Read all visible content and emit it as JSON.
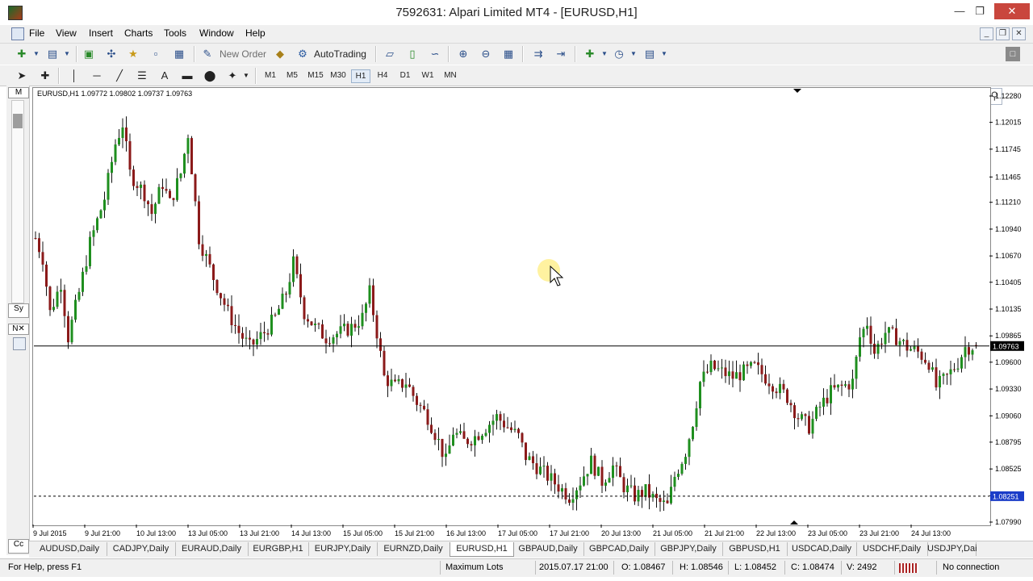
{
  "window": {
    "title": "7592631: Alpari Limited MT4 - [EURUSD,H1]"
  },
  "menu": [
    "File",
    "View",
    "Insert",
    "Charts",
    "Tools",
    "Window",
    "Help"
  ],
  "toolbar": {
    "new_order": "New Order",
    "autotrading": "AutoTrading"
  },
  "timeframes": [
    "M1",
    "M5",
    "M15",
    "M30",
    "H1",
    "H4",
    "D1",
    "W1",
    "MN"
  ],
  "active_timeframe": "H1",
  "chart": {
    "header": "EURUSD,H1  1.09772 1.09802 1.09737 1.09763",
    "price_labels": [
      "1.12280",
      "1.12015",
      "1.11745",
      "1.11465",
      "1.11210",
      "1.10940",
      "1.10670",
      "1.10405",
      "1.10135",
      "1.09865",
      "1.09600",
      "1.09330",
      "1.09060",
      "1.08795",
      "1.08525",
      "1.08255",
      "1.07990"
    ],
    "current_price": "1.09763",
    "line_price": "1.08251",
    "time_labels": [
      "9 Jul 2015",
      "9 Jul 21:00",
      "10 Jul 13:00",
      "13 Jul 05:00",
      "13 Jul 21:00",
      "14 Jul 13:00",
      "15 Jul 05:00",
      "15 Jul 21:00",
      "16 Jul 13:00",
      "17 Jul 05:00",
      "17 Jul 21:00",
      "20 Jul 13:00",
      "21 Jul 05:00",
      "21 Jul 21:00",
      "22 Jul 13:00",
      "23 Jul 05:00",
      "23 Jul 21:00",
      "24 Jul 13:00"
    ],
    "colors": {
      "bull": "#1f8f1f",
      "bear": "#8b1a1a",
      "neutral": "#000000",
      "highlight_cursor": "#fff2a0"
    }
  },
  "chart_data": {
    "type": "candlestick",
    "title": "EURUSD,H1",
    "ylim": [
      1.0799,
      1.1228
    ],
    "close_path": [
      [
        0,
        1.1085
      ],
      [
        2,
        1.1065
      ],
      [
        4,
        1.101
      ],
      [
        7,
        1.104
      ],
      [
        9,
        1.0985
      ],
      [
        12,
        1.103
      ],
      [
        15,
        1.108
      ],
      [
        19,
        1.1125
      ],
      [
        22,
        1.118
      ],
      [
        24,
        1.12
      ],
      [
        26,
        1.115
      ],
      [
        30,
        1.113
      ],
      [
        32,
        1.111
      ],
      [
        35,
        1.114
      ],
      [
        37,
        1.112
      ],
      [
        40,
        1.115
      ],
      [
        42,
        1.119
      ],
      [
        45,
        1.1085
      ],
      [
        49,
        1.1045
      ],
      [
        53,
        1.101
      ],
      [
        56,
        1.099
      ],
      [
        59,
        1.0975
      ],
      [
        63,
        1.099
      ],
      [
        66,
        1.1005
      ],
      [
        69,
        1.103
      ],
      [
        71,
        1.106
      ],
      [
        74,
        1.101
      ],
      [
        77,
        1.0995
      ],
      [
        80,
        1.0985
      ],
      [
        84,
        1.099
      ],
      [
        87,
        1.0995
      ],
      [
        90,
        1.1005
      ],
      [
        92,
        1.103
      ],
      [
        94,
        1.099
      ],
      [
        96,
        1.0945
      ],
      [
        99,
        1.0935
      ],
      [
        102,
        1.094
      ],
      [
        105,
        1.092
      ],
      [
        108,
        1.0905
      ],
      [
        111,
        1.088
      ],
      [
        113,
        1.086
      ],
      [
        115,
        1.089
      ],
      [
        118,
        1.088
      ],
      [
        121,
        1.0885
      ],
      [
        124,
        1.0895
      ],
      [
        127,
        1.0905
      ],
      [
        130,
        1.0895
      ],
      [
        133,
        1.0885
      ],
      [
        135,
        1.0865
      ],
      [
        138,
        1.0855
      ],
      [
        141,
        1.0845
      ],
      [
        144,
        1.0835
      ],
      [
        147,
        1.0825
      ],
      [
        150,
        1.084
      ],
      [
        153,
        1.086
      ],
      [
        156,
        1.084
      ],
      [
        159,
        1.0855
      ],
      [
        162,
        1.0835
      ],
      [
        165,
        1.0825
      ],
      [
        168,
        1.083
      ],
      [
        171,
        1.082
      ],
      [
        174,
        1.0815
      ],
      [
        176,
        1.0845
      ],
      [
        179,
        1.087
      ],
      [
        181,
        1.09
      ],
      [
        183,
        1.094
      ],
      [
        186,
        1.0955
      ],
      [
        189,
        1.095
      ],
      [
        192,
        1.0945
      ],
      [
        195,
        1.095
      ],
      [
        198,
        1.0955
      ],
      [
        201,
        1.0945
      ],
      [
        204,
        1.0935
      ],
      [
        207,
        1.0925
      ],
      [
        210,
        1.0905
      ],
      [
        213,
        1.0895
      ],
      [
        216,
        1.0915
      ],
      [
        219,
        1.093
      ],
      [
        222,
        1.0935
      ],
      [
        225,
        1.094
      ],
      [
        227,
        1.0985
      ],
      [
        229,
        1.1
      ],
      [
        231,
        1.097
      ],
      [
        234,
        1.099
      ],
      [
        237,
        1.0985
      ],
      [
        240,
        1.0975
      ],
      [
        243,
        1.097
      ],
      [
        246,
        1.096
      ],
      [
        248,
        1.0935
      ],
      [
        251,
        1.0945
      ],
      [
        254,
        1.096
      ],
      [
        256,
        1.0975
      ],
      [
        258,
        1.0976
      ]
    ],
    "x_labels": [
      "9 Jul 2015",
      "9 Jul 21:00",
      "10 Jul 13:00",
      "13 Jul 05:00",
      "13 Jul 21:00",
      "14 Jul 13:00",
      "15 Jul 05:00",
      "15 Jul 21:00",
      "16 Jul 13:00",
      "17 Jul 05:00",
      "17 Jul 21:00",
      "20 Jul 13:00",
      "21 Jul 05:00",
      "21 Jul 21:00",
      "22 Jul 13:00",
      "23 Jul 05:00",
      "23 Jul 21:00",
      "24 Jul 13:00"
    ],
    "horizontal_lines": [
      1.09763,
      1.08251
    ]
  },
  "tabs": [
    "AUDUSD,Daily",
    "CADJPY,Daily",
    "EURAUD,Daily",
    "EURGBP,H1",
    "EURJPY,Daily",
    "EURNZD,Daily",
    "EURUSD,H1",
    "GBPAUD,Daily",
    "GBPCAD,Daily",
    "GBPJPY,Daily",
    "GBPUSD,H1",
    "USDCAD,Daily",
    "USDCHF,Daily",
    "USDJPY,Dai"
  ],
  "active_tab": "EURUSD,H1",
  "status": {
    "help": "For Help, press F1",
    "profile": "Maximum Lots",
    "time": "2015.07.17 21:00",
    "open": "O: 1.08467",
    "high": "H: 1.08546",
    "low": "L: 1.08452",
    "close": "C: 1.08474",
    "volume": "V: 2492",
    "connection": "No connection"
  }
}
